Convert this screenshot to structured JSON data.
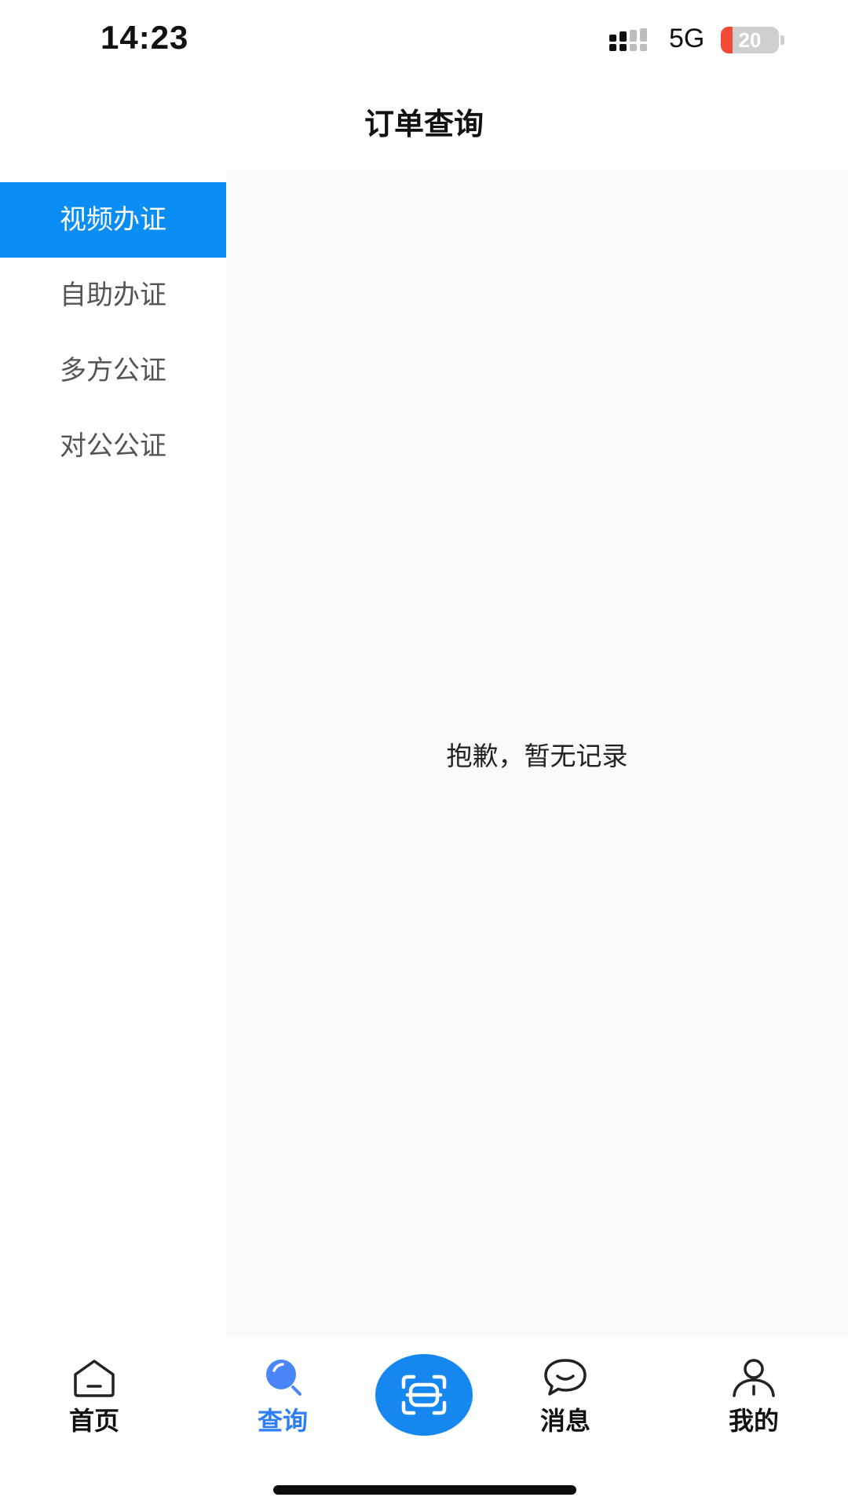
{
  "status_bar": {
    "time": "14:23",
    "network": "5G",
    "battery_level": "20",
    "battery_fraction": 0.2,
    "battery_color": "#f24a37"
  },
  "header": {
    "title": "订单查询"
  },
  "sidebar": {
    "items": [
      {
        "label": "视频办证",
        "active": true
      },
      {
        "label": "自助办证",
        "active": false
      },
      {
        "label": "多方公证",
        "active": false
      },
      {
        "label": "对公公证",
        "active": false
      }
    ],
    "active_color": "#0a8ef5"
  },
  "content": {
    "empty_message": "抱歉，暂无记录"
  },
  "tabbar": {
    "tabs": [
      {
        "label": "首页",
        "icon": "home-icon",
        "active": false
      },
      {
        "label": "查询",
        "icon": "search-icon",
        "active": true
      },
      {
        "label": "",
        "icon": "scan-icon",
        "active": false
      },
      {
        "label": "消息",
        "icon": "message-icon",
        "active": false
      },
      {
        "label": "我的",
        "icon": "user-icon",
        "active": false
      }
    ],
    "active_color": "#2d7ff3",
    "scan_color": "#1787f0"
  }
}
